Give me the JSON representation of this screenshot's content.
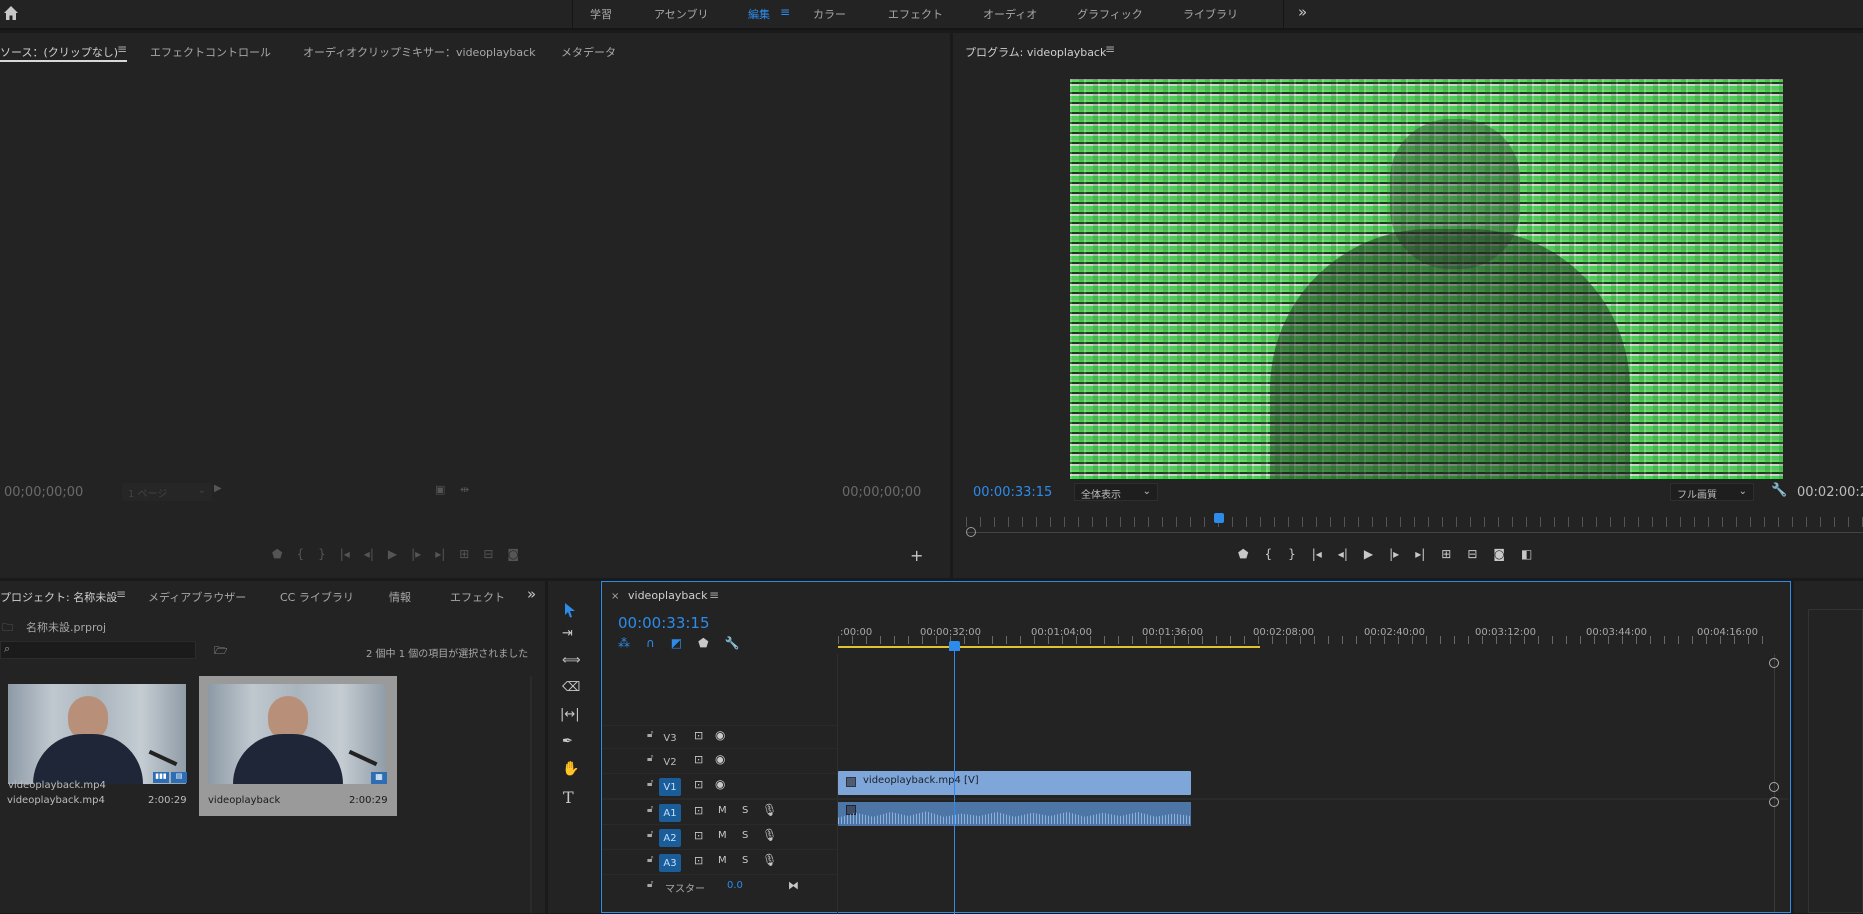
{
  "workspaces": [
    "学習",
    "アセンブリ",
    "編集",
    "カラー",
    "エフェクト",
    "オーディオ",
    "グラフィック",
    "ライブラリ"
  ],
  "active_workspace": "編集",
  "source_panel": {
    "tabs": [
      "ソース：(クリップなし)",
      "エフェクトコントロール",
      "オーディオクリップミキサー：videoplayback",
      "メタデータ"
    ],
    "timecode_left": "00;00;00;00",
    "timecode_right": "00;00;00;00",
    "page_select": "1 ページ"
  },
  "program_panel": {
    "title": "プログラム: videoplayback",
    "timecode_current": "00:00:33:15",
    "zoom_select": "全体表示",
    "quality_select": "フル画質",
    "timecode_duration": "00:02:00:2"
  },
  "project_panel": {
    "tabs": [
      "プロジェクト: 名称未設",
      "メディアブラウザー",
      "CC ライブラリ",
      "情報",
      "エフェクト"
    ],
    "project_file": "名称未設.prproj",
    "search_placeholder": "",
    "selection_status": "2 個中 1 個の項目が選択されました",
    "items": [
      {
        "name": "videoplayback.mp4",
        "duration": "2:00:29",
        "selected": false
      },
      {
        "name": "videoplayback",
        "duration": "2:00:29",
        "selected": true
      }
    ]
  },
  "timeline": {
    "sequence_name": "videoplayback",
    "timecode": "00:00:33:15",
    "ruler_labels": [
      ":00:00",
      "00:00:32:00",
      "00:01:04:00",
      "00:01:36:00",
      "00:02:08:00",
      "00:02:40:00",
      "00:03:12:00",
      "00:03:44:00",
      "00:04:16:00"
    ],
    "video_tracks": [
      "V3",
      "V2",
      "V1"
    ],
    "audio_tracks": [
      "A1",
      "A2",
      "A3"
    ],
    "audio_toggles": [
      "M",
      "S"
    ],
    "master_label": "マスター",
    "master_value": "0.0",
    "video_clip_label": "videoplayback.mp4 [V]"
  },
  "colors": {
    "accent": "#2d8ceb",
    "clip_video": "#7fa6d9",
    "clip_audio": "#4d76a6",
    "work_area": "#e0c233"
  }
}
